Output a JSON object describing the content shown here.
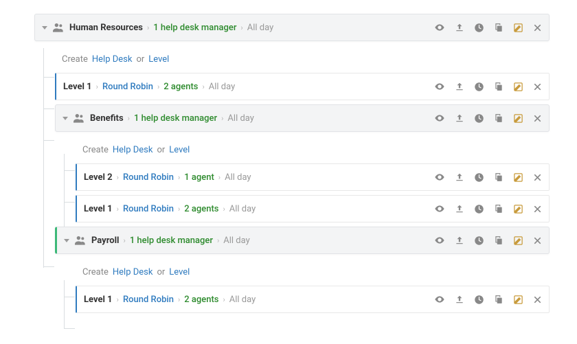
{
  "labels": {
    "create": "Create",
    "helpdesk_link": "Help Desk",
    "or": "or",
    "level_link": "Level",
    "round_robin": "Round Robin",
    "all_day": "All day",
    "sep": "›"
  },
  "nodes": [
    {
      "type": "dept",
      "indent": 50,
      "key": "hr",
      "name": "Human Resources",
      "manager": "1 help desk manager",
      "allday": "All day",
      "children": [
        {
          "type": "create",
          "indent": 80
        },
        {
          "type": "level",
          "indent": 80,
          "level": "Level 1",
          "assign": "Round Robin",
          "agents": "2 agents",
          "allday": "All day"
        },
        {
          "type": "dept",
          "indent": 80,
          "key": "benefits",
          "name": "Benefits",
          "manager": "1 help desk manager",
          "allday": "All day",
          "children": [
            {
              "type": "create",
              "indent": 110
            },
            {
              "type": "level",
              "indent": 110,
              "level": "Level 2",
              "assign": "Round Robin",
              "agents": "1 agent",
              "allday": "All day"
            },
            {
              "type": "level",
              "indent": 110,
              "level": "Level 1",
              "assign": "Round Robin",
              "agents": "2 agents",
              "allday": "All day"
            }
          ]
        },
        {
          "type": "dept",
          "indent": 80,
          "classExtra": "dept-payroll",
          "key": "payroll",
          "name": "Payroll",
          "manager": "1 help desk manager",
          "allday": "All day",
          "children": [
            {
              "type": "create",
              "indent": 110
            },
            {
              "type": "level",
              "indent": 110,
              "level": "Level 1",
              "assign": "Round Robin",
              "agents": "2 agents",
              "allday": "All day"
            }
          ]
        }
      ]
    }
  ]
}
